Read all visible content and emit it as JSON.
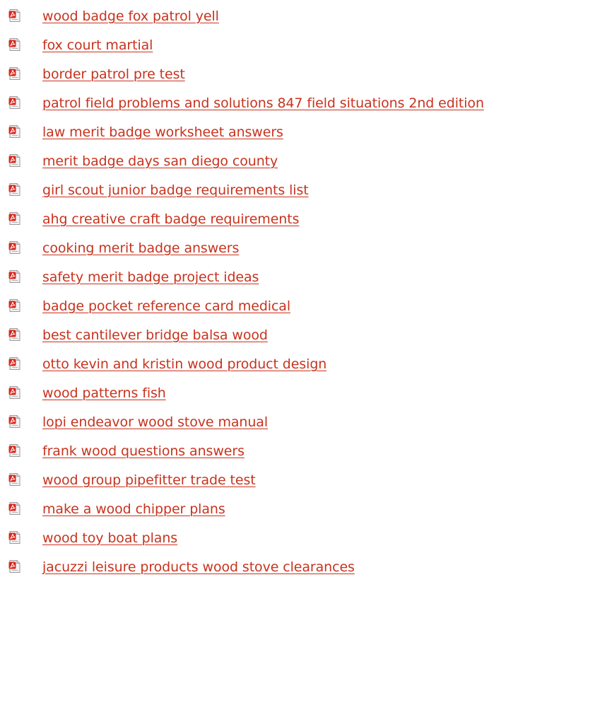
{
  "links": [
    {
      "label": "wood badge fox patrol yell"
    },
    {
      "label": "fox court martial"
    },
    {
      "label": "border patrol pre test"
    },
    {
      "label": "patrol field problems and solutions 847 field situations 2nd edition"
    },
    {
      "label": "law merit badge worksheet answers"
    },
    {
      "label": "merit badge days san diego county"
    },
    {
      "label": "girl scout junior badge requirements list"
    },
    {
      "label": "ahg creative craft badge requirements"
    },
    {
      "label": "cooking merit badge answers"
    },
    {
      "label": "safety merit badge project ideas"
    },
    {
      "label": "badge pocket reference card medical"
    },
    {
      "label": "best cantilever bridge balsa wood"
    },
    {
      "label": "otto kevin and kristin wood product design"
    },
    {
      "label": "wood patterns fish"
    },
    {
      "label": "lopi endeavor wood stove manual"
    },
    {
      "label": "frank wood questions answers"
    },
    {
      "label": "wood group pipefitter trade test"
    },
    {
      "label": "make a wood chipper plans"
    },
    {
      "label": "wood toy boat plans"
    },
    {
      "label": "jacuzzi leisure products wood stove clearances"
    }
  ],
  "colors": {
    "link": "#c8331e",
    "icon_red": "#d8281e"
  },
  "icon": "pdf-file-icon"
}
